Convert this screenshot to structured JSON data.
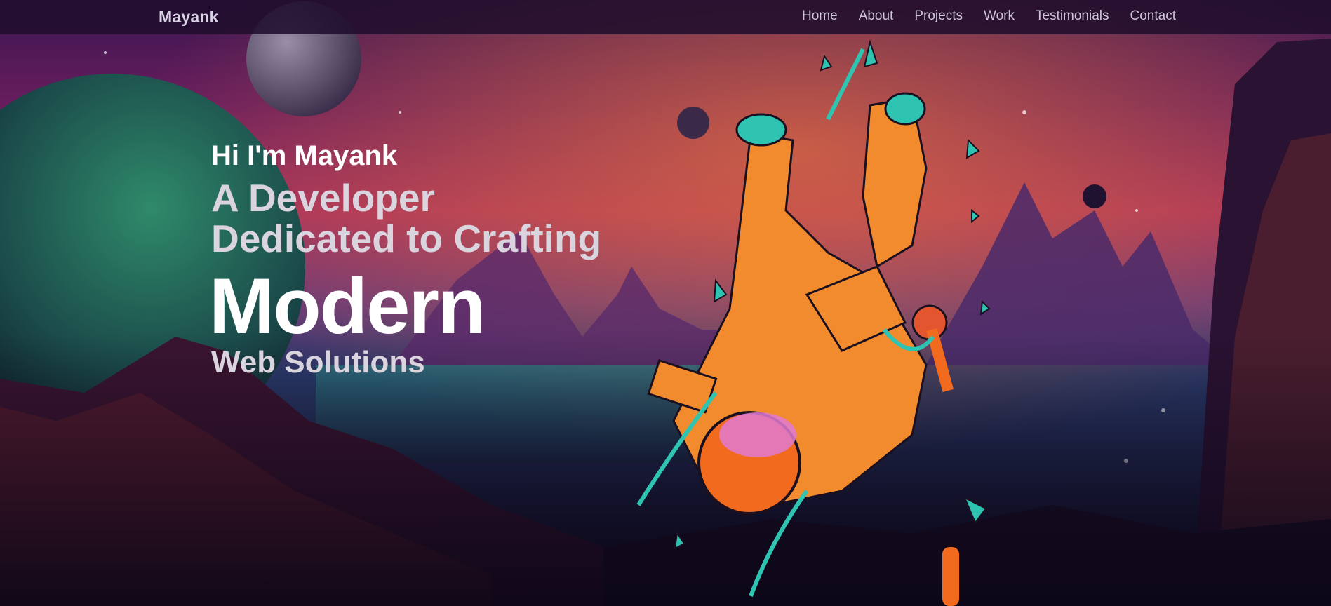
{
  "nav": {
    "logo": "Mayank",
    "links": [
      "Home",
      "About",
      "Projects",
      "Work",
      "Testimonials",
      "Contact"
    ]
  },
  "hero": {
    "greeting": "Hi I'm Mayank",
    "line2": "A Developer",
    "line3": "Dedicated to Crafting",
    "highlight": "Modern",
    "line5": "Web Solutions"
  },
  "colors": {
    "nav_bg": "#200e2c",
    "text_primary": "#ffffff",
    "text_secondary": "#d9d4de",
    "accent_orange": "#f28a2e",
    "accent_teal": "#2fc4b2"
  }
}
